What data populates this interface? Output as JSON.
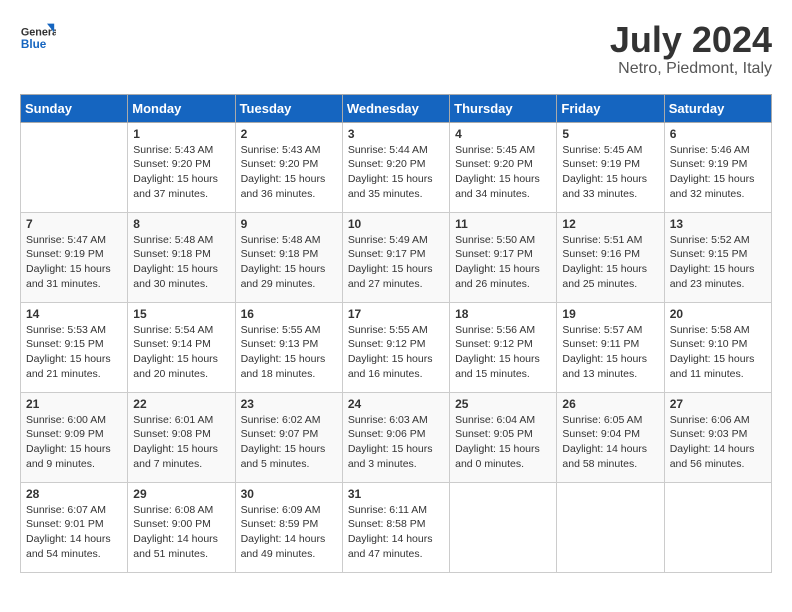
{
  "header": {
    "logo_line1": "General",
    "logo_line2": "Blue",
    "title": "July 2024",
    "subtitle": "Netro, Piedmont, Italy"
  },
  "weekdays": [
    "Sunday",
    "Monday",
    "Tuesday",
    "Wednesday",
    "Thursday",
    "Friday",
    "Saturday"
  ],
  "weeks": [
    [
      {
        "day": "",
        "info": ""
      },
      {
        "day": "1",
        "info": "Sunrise: 5:43 AM\nSunset: 9:20 PM\nDaylight: 15 hours\nand 37 minutes."
      },
      {
        "day": "2",
        "info": "Sunrise: 5:43 AM\nSunset: 9:20 PM\nDaylight: 15 hours\nand 36 minutes."
      },
      {
        "day": "3",
        "info": "Sunrise: 5:44 AM\nSunset: 9:20 PM\nDaylight: 15 hours\nand 35 minutes."
      },
      {
        "day": "4",
        "info": "Sunrise: 5:45 AM\nSunset: 9:20 PM\nDaylight: 15 hours\nand 34 minutes."
      },
      {
        "day": "5",
        "info": "Sunrise: 5:45 AM\nSunset: 9:19 PM\nDaylight: 15 hours\nand 33 minutes."
      },
      {
        "day": "6",
        "info": "Sunrise: 5:46 AM\nSunset: 9:19 PM\nDaylight: 15 hours\nand 32 minutes."
      }
    ],
    [
      {
        "day": "7",
        "info": "Sunrise: 5:47 AM\nSunset: 9:19 PM\nDaylight: 15 hours\nand 31 minutes."
      },
      {
        "day": "8",
        "info": "Sunrise: 5:48 AM\nSunset: 9:18 PM\nDaylight: 15 hours\nand 30 minutes."
      },
      {
        "day": "9",
        "info": "Sunrise: 5:48 AM\nSunset: 9:18 PM\nDaylight: 15 hours\nand 29 minutes."
      },
      {
        "day": "10",
        "info": "Sunrise: 5:49 AM\nSunset: 9:17 PM\nDaylight: 15 hours\nand 27 minutes."
      },
      {
        "day": "11",
        "info": "Sunrise: 5:50 AM\nSunset: 9:17 PM\nDaylight: 15 hours\nand 26 minutes."
      },
      {
        "day": "12",
        "info": "Sunrise: 5:51 AM\nSunset: 9:16 PM\nDaylight: 15 hours\nand 25 minutes."
      },
      {
        "day": "13",
        "info": "Sunrise: 5:52 AM\nSunset: 9:15 PM\nDaylight: 15 hours\nand 23 minutes."
      }
    ],
    [
      {
        "day": "14",
        "info": "Sunrise: 5:53 AM\nSunset: 9:15 PM\nDaylight: 15 hours\nand 21 minutes."
      },
      {
        "day": "15",
        "info": "Sunrise: 5:54 AM\nSunset: 9:14 PM\nDaylight: 15 hours\nand 20 minutes."
      },
      {
        "day": "16",
        "info": "Sunrise: 5:55 AM\nSunset: 9:13 PM\nDaylight: 15 hours\nand 18 minutes."
      },
      {
        "day": "17",
        "info": "Sunrise: 5:55 AM\nSunset: 9:12 PM\nDaylight: 15 hours\nand 16 minutes."
      },
      {
        "day": "18",
        "info": "Sunrise: 5:56 AM\nSunset: 9:12 PM\nDaylight: 15 hours\nand 15 minutes."
      },
      {
        "day": "19",
        "info": "Sunrise: 5:57 AM\nSunset: 9:11 PM\nDaylight: 15 hours\nand 13 minutes."
      },
      {
        "day": "20",
        "info": "Sunrise: 5:58 AM\nSunset: 9:10 PM\nDaylight: 15 hours\nand 11 minutes."
      }
    ],
    [
      {
        "day": "21",
        "info": "Sunrise: 6:00 AM\nSunset: 9:09 PM\nDaylight: 15 hours\nand 9 minutes."
      },
      {
        "day": "22",
        "info": "Sunrise: 6:01 AM\nSunset: 9:08 PM\nDaylight: 15 hours\nand 7 minutes."
      },
      {
        "day": "23",
        "info": "Sunrise: 6:02 AM\nSunset: 9:07 PM\nDaylight: 15 hours\nand 5 minutes."
      },
      {
        "day": "24",
        "info": "Sunrise: 6:03 AM\nSunset: 9:06 PM\nDaylight: 15 hours\nand 3 minutes."
      },
      {
        "day": "25",
        "info": "Sunrise: 6:04 AM\nSunset: 9:05 PM\nDaylight: 15 hours\nand 0 minutes."
      },
      {
        "day": "26",
        "info": "Sunrise: 6:05 AM\nSunset: 9:04 PM\nDaylight: 14 hours\nand 58 minutes."
      },
      {
        "day": "27",
        "info": "Sunrise: 6:06 AM\nSunset: 9:03 PM\nDaylight: 14 hours\nand 56 minutes."
      }
    ],
    [
      {
        "day": "28",
        "info": "Sunrise: 6:07 AM\nSunset: 9:01 PM\nDaylight: 14 hours\nand 54 minutes."
      },
      {
        "day": "29",
        "info": "Sunrise: 6:08 AM\nSunset: 9:00 PM\nDaylight: 14 hours\nand 51 minutes."
      },
      {
        "day": "30",
        "info": "Sunrise: 6:09 AM\nSunset: 8:59 PM\nDaylight: 14 hours\nand 49 minutes."
      },
      {
        "day": "31",
        "info": "Sunrise: 6:11 AM\nSunset: 8:58 PM\nDaylight: 14 hours\nand 47 minutes."
      },
      {
        "day": "",
        "info": ""
      },
      {
        "day": "",
        "info": ""
      },
      {
        "day": "",
        "info": ""
      }
    ]
  ]
}
